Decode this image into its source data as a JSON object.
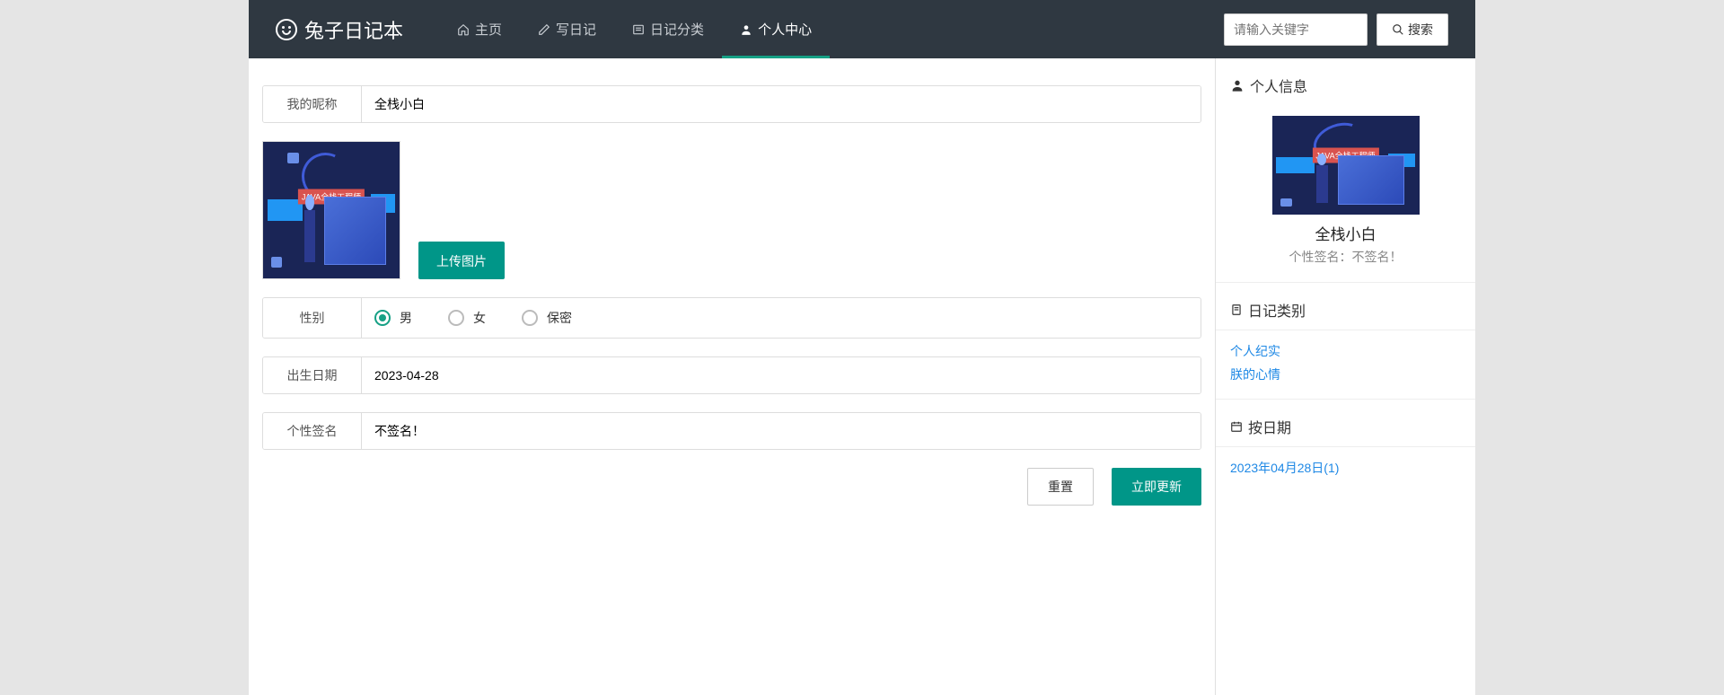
{
  "brand": "兔子日记本",
  "nav": {
    "home": "主页",
    "write": "写日记",
    "categories": "日记分类",
    "profile": "个人中心"
  },
  "search": {
    "placeholder": "请输入关键字",
    "button": "搜索"
  },
  "form": {
    "nickname_label": "我的昵称",
    "nickname_value": "全栈小白",
    "upload_label": "上传图片",
    "gender_label": "性别",
    "gender_male": "男",
    "gender_female": "女",
    "gender_secret": "保密",
    "birth_label": "出生日期",
    "birth_value": "2023-04-28",
    "signature_label": "个性签名",
    "signature_value": "不签名！",
    "reset": "重置",
    "submit": "立即更新",
    "image_banner": "JAVA全栈工程师"
  },
  "sidebar": {
    "info_title": "个人信息",
    "name": "全栈小白",
    "signature_label": "个性签名：",
    "signature_value": "不签名！",
    "category_title": "日记类别",
    "categories": [
      "个人纪实",
      "朕的心情"
    ],
    "date_title": "按日期",
    "dates": [
      "2023年04月28日(1)"
    ]
  }
}
